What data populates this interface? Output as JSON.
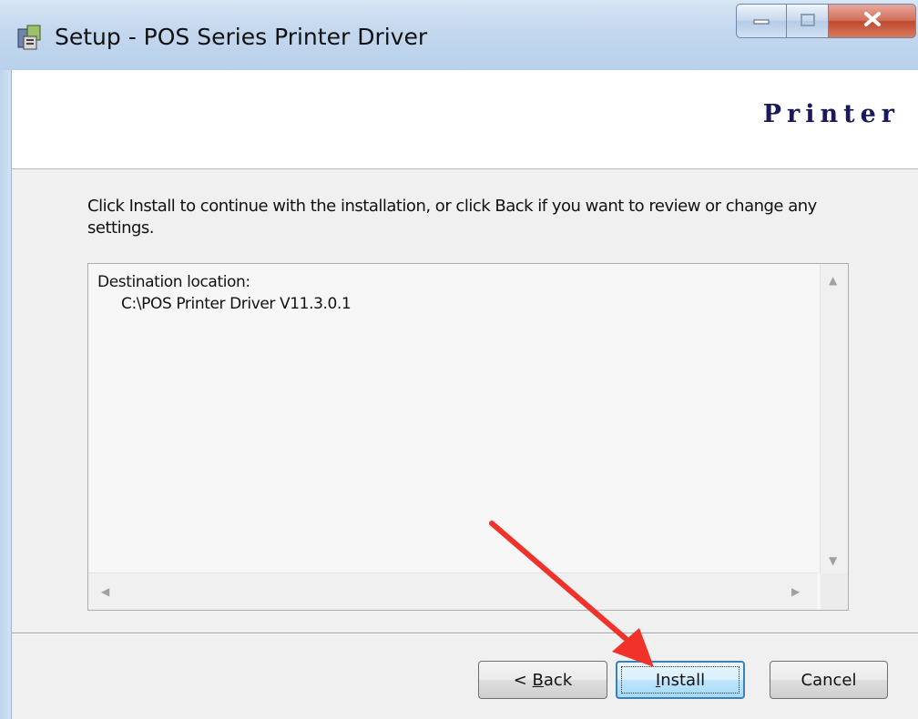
{
  "window": {
    "title": "Setup - POS Series Printer Driver"
  },
  "header": {
    "brand": "Printer"
  },
  "main": {
    "instruction": "Click Install to continue with the installation, or click Back if you want to review or change any settings.",
    "memo": {
      "line1": "Destination location:",
      "line2": "C:\\POS Printer Driver V11.3.0.1"
    }
  },
  "buttons": {
    "back_prefix": "< ",
    "back_accel": "B",
    "back_rest": "ack",
    "install_accel": "I",
    "install_rest": "nstall",
    "cancel": "Cancel"
  },
  "icons": {
    "app": "installer-icon",
    "minimize": "minimize-icon",
    "maximize": "maximize-icon",
    "close": "close-icon",
    "annotation": "red-arrow-icon"
  },
  "colors": {
    "annotation_arrow": "#f0322a",
    "install_focus_border": "#3c7fb1",
    "brand_text": "#1a1a5a"
  }
}
